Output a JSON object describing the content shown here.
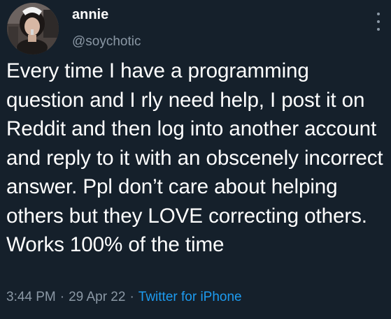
{
  "tweet": {
    "author": {
      "display_name": "annie",
      "handle": "@soychotic"
    },
    "text": "Every time I have a programming question and I rly need help, I post it on Reddit and then log into another account and reply to it with an obscenely incorrect answer. Ppl don’t care about helping others but they LOVE correcting others. Works 100% of the time",
    "time": "3:44 PM",
    "separator": "·",
    "date": "29 Apr 22",
    "source": "Twitter for iPhone"
  },
  "icons": {
    "more": "more-vertical-icon",
    "avatar": "profile-photo"
  },
  "colors": {
    "background": "#15202b",
    "text": "#ffffff",
    "secondary": "#8b98a5",
    "link": "#1d9bf0"
  }
}
